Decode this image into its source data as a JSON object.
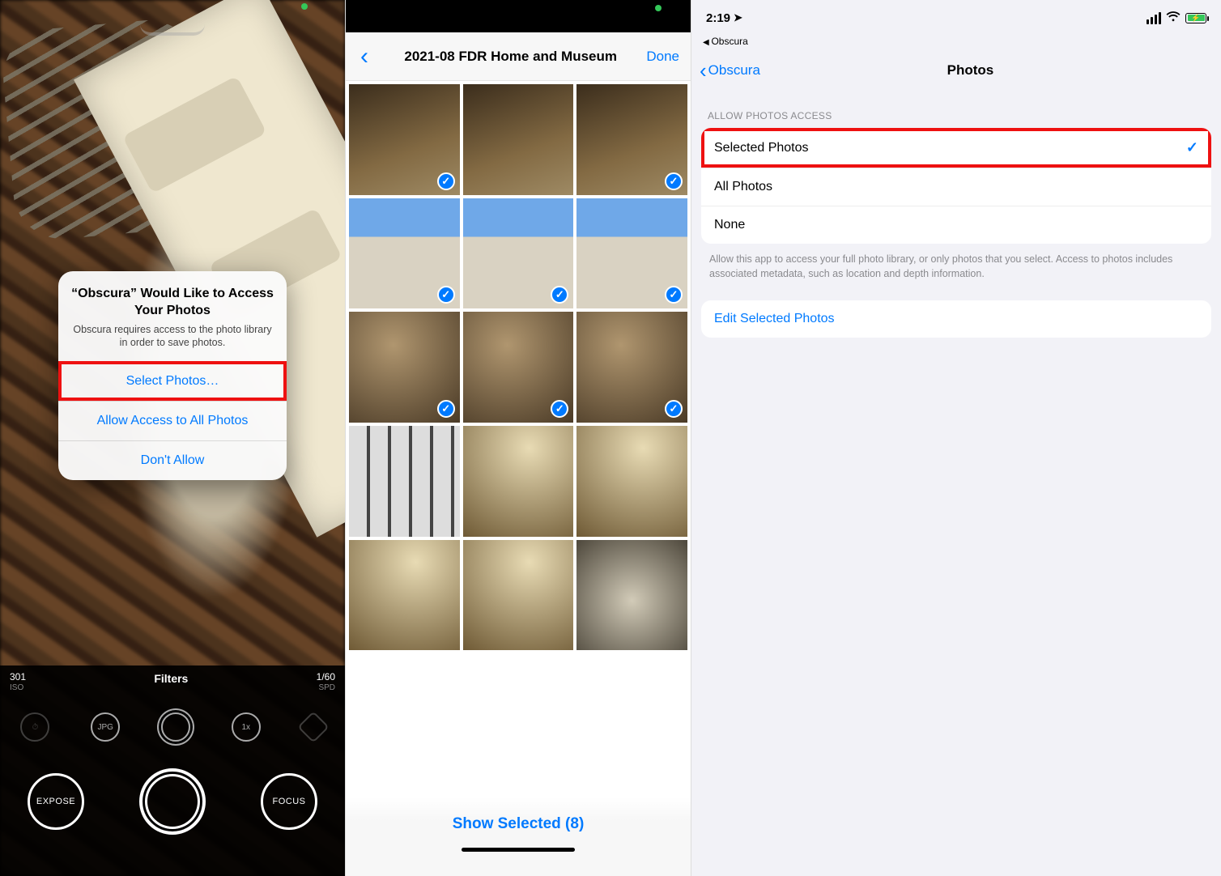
{
  "panel1": {
    "dialog": {
      "title": "“Obscura” Would Like to Access Your Photos",
      "message": "Obscura requires access to the photo library in order to save photos.",
      "buttons": {
        "select": "Select Photos…",
        "allow_all": "Allow Access to All Photos",
        "deny": "Don't Allow"
      }
    },
    "bottom": {
      "iso_value": "301",
      "iso_label": "ISO",
      "filters_label": "Filters",
      "spd_value": "1/60",
      "spd_label": "SPD",
      "chip_jpg": "JPG",
      "chip_zoom": "1x",
      "expose": "EXPOSE",
      "focus": "FOCUS"
    }
  },
  "panel2": {
    "header": {
      "title": "2021-08 FDR Home and Museum",
      "done": "Done"
    },
    "thumbs": [
      {
        "kind": "t-statue",
        "selected": true
      },
      {
        "kind": "t-statue",
        "selected": false
      },
      {
        "kind": "t-statue",
        "selected": true
      },
      {
        "kind": "t-house",
        "selected": true
      },
      {
        "kind": "t-house",
        "selected": true
      },
      {
        "kind": "t-house",
        "selected": true
      },
      {
        "kind": "t-interior",
        "selected": true
      },
      {
        "kind": "t-interior",
        "selected": true
      },
      {
        "kind": "t-interior",
        "selected": true
      },
      {
        "kind": "t-frames",
        "selected": false
      },
      {
        "kind": "t-living",
        "selected": false
      },
      {
        "kind": "t-living",
        "selected": false
      },
      {
        "kind": "t-living",
        "selected": false
      },
      {
        "kind": "t-living",
        "selected": false
      },
      {
        "kind": "t-metal",
        "selected": false
      }
    ],
    "footer": {
      "show_selected": "Show Selected (8)"
    }
  },
  "panel3": {
    "statusbar": {
      "time": "2:19"
    },
    "breadcrumb": "Obscura",
    "nav": {
      "back": "Obscura",
      "title": "Photos"
    },
    "section_header": "ALLOW PHOTOS ACCESS",
    "options": {
      "selected_photos": "Selected Photos",
      "all_photos": "All Photos",
      "none": "None"
    },
    "footer_note": "Allow this app to access your full photo library, or only photos that you select. Access to photos includes associated metadata, such as location and depth information.",
    "edit_selected": "Edit Selected Photos"
  }
}
